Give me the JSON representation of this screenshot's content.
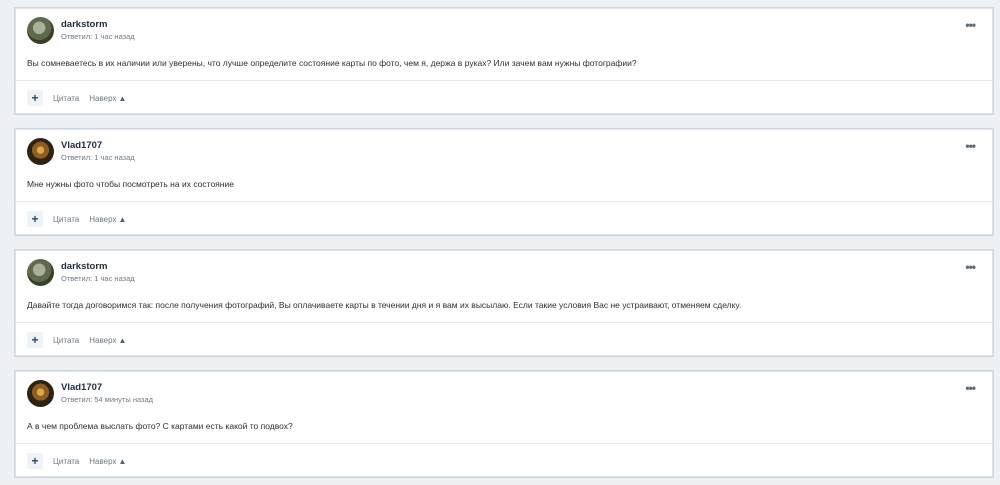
{
  "posts": [
    {
      "author": "darkstorm",
      "meta": "Ответил: 1 час назад",
      "content": "Вы сомневаетесь в их наличии или уверены, что лучше определите состояние карты по фото, чем я, держа в руках? Или зачем вам нужны фотографии?",
      "avatar": "darkstorm-avatar",
      "actions": {
        "plus": "+",
        "quote": "Цитата",
        "top": "Наверх"
      }
    },
    {
      "author": "Vlad1707",
      "meta": "Ответил: 1 час назад",
      "content": "Мне нужны фото чтобы посмотреть на их состояние",
      "avatar": "vlad1707-avatar",
      "actions": {
        "plus": "+",
        "quote": "Цитата",
        "top": "Наверх"
      }
    },
    {
      "author": "darkstorm",
      "meta": "Ответил: 1 час назад",
      "content": "Давайте тогда договоримся так: после получения фотографий, Вы оплачиваете карты в течении дня и я вам их высылаю. Если такие условия Вас не устраивают, отменяем сделку.",
      "avatar": "darkstorm-avatar",
      "actions": {
        "plus": "+",
        "quote": "Цитата",
        "top": "Наверх"
      }
    },
    {
      "author": "Vlad1707",
      "meta": "Ответил: 54 минуты назад",
      "content": "А в чем проблема выслать фото? С картами есть какой то подвох?",
      "avatar": "vlad1707-avatar",
      "actions": {
        "plus": "+",
        "quote": "Цитата",
        "top": "Наверх"
      }
    }
  ],
  "menu_icon": "more-icon",
  "arrow_icon": "arrow-up-icon"
}
